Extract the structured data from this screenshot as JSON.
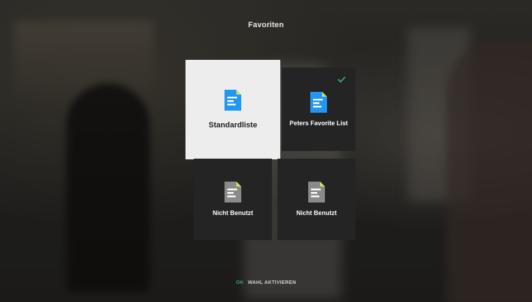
{
  "screen": {
    "title": "Favoriten"
  },
  "tiles": [
    {
      "label": "Standardliste",
      "selected": true,
      "icon": "document-icon",
      "icon_color": "#2196f3"
    },
    {
      "label": "Peters Favorite List",
      "selected": false,
      "checked": true,
      "icon": "document-icon",
      "icon_color": "#2196f3"
    },
    {
      "label": "Nicht Benutzt",
      "selected": false,
      "icon": "document-icon",
      "icon_color": "#8a8a8a"
    },
    {
      "label": "Nicht Benutzt",
      "selected": false,
      "icon": "document-icon",
      "icon_color": "#8a8a8a"
    }
  ],
  "hint": {
    "key_label": "OK",
    "text": "WAHL AKTIVIEREN"
  },
  "colors": {
    "accent_blue": "#2196f3",
    "check_green": "#2aa66a",
    "folded_corner_yellow": "#d4e157",
    "tile_dark": "#242424",
    "tile_selected": "#ededed"
  }
}
